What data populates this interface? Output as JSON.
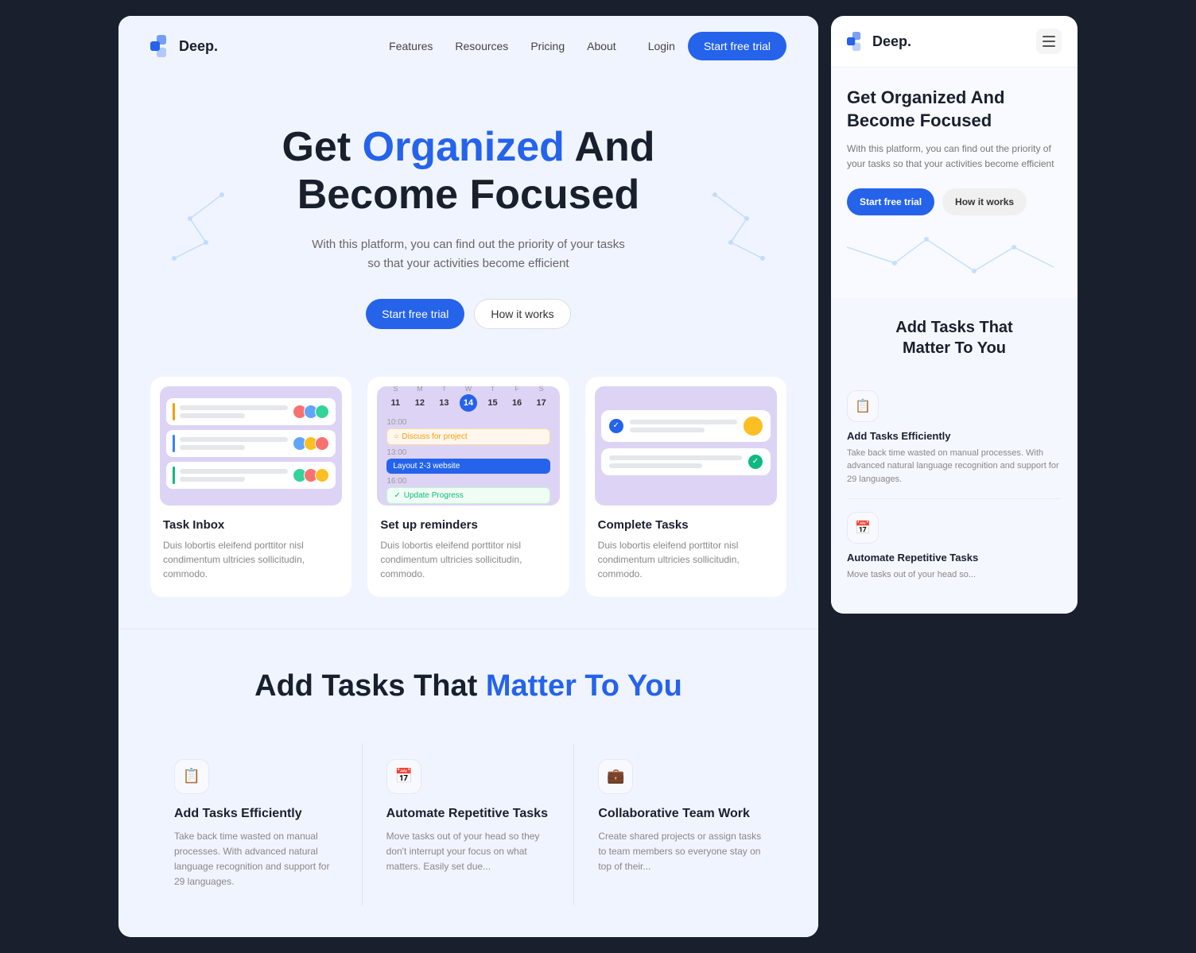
{
  "brand": {
    "name": "Deep.",
    "logo_alt": "Deep logo"
  },
  "nav": {
    "links": [
      {
        "label": "Features",
        "has_arrow": true
      },
      {
        "label": "Resources",
        "has_arrow": true
      },
      {
        "label": "Pricing",
        "has_arrow": false
      },
      {
        "label": "About",
        "has_arrow": false
      }
    ],
    "login_label": "Login",
    "cta_label": "Start free trial"
  },
  "hero": {
    "title_part1": "Get ",
    "title_highlight": "Organized",
    "title_part2": " And",
    "title_line2": "Become Focused",
    "subtitle": "With this platform, you can find out the priority of your tasks so that your activities become efficient",
    "cta_primary": "Start free trial",
    "cta_secondary": "How it works"
  },
  "cards": [
    {
      "id": "task-inbox",
      "title": "Task Inbox",
      "desc": "Duis lobortis eleifend porttitor nisl condimentum ultricies sollicitudin, commodo."
    },
    {
      "id": "set-up-reminders",
      "title": "Set up reminders",
      "desc": "Duis lobortis eleifend porttitor nisl condimentum ultricies sollicitudin, commodo."
    },
    {
      "id": "complete-tasks",
      "title": "Complete Tasks",
      "desc": "Duis lobortis eleifend porttitor nisl condimentum ultricies sollicitudin, commodo."
    }
  ],
  "tasks_section": {
    "title_part1": "Add Tasks That ",
    "title_highlight": "Matter To You"
  },
  "features": [
    {
      "id": "add-tasks",
      "icon": "📋",
      "title": "Add Tasks Efficiently",
      "desc": "Take back time wasted on manual processes. With advanced natural language recognition and support for 29 languages."
    },
    {
      "id": "automate",
      "icon": "📅",
      "title": "Automate Repetitive Tasks",
      "desc": "Move tasks out of your head so they don't interrupt your focus on what matters. Easily set due..."
    },
    {
      "id": "collaborate",
      "icon": "💼",
      "title": "Collaborative Team Work",
      "desc": "Create shared projects or assign tasks to team members so everyone stay on top of their..."
    }
  ],
  "calendar": {
    "days": [
      "S",
      "M",
      "T",
      "W",
      "T",
      "F",
      "S"
    ],
    "dates": [
      "11",
      "12",
      "13",
      "14",
      "15",
      "16",
      "17"
    ],
    "active_day": "14",
    "events": [
      {
        "time": "10:00",
        "label": "Discuss for project",
        "type": "orange"
      },
      {
        "time": "13:00",
        "label": "Layout 2-3 website",
        "type": "blue"
      },
      {
        "time": "16:00",
        "label": "Update Progress",
        "type": "green"
      }
    ]
  },
  "right_panel": {
    "hero": {
      "title_part1": "Get ",
      "title_highlight": "Organized",
      "title_part2": " And\nBecome Focused",
      "subtitle": "With this platform, you can find out the priority of your tasks so that your activities become efficient",
      "cta_primary": "Start free trial",
      "cta_secondary": "How it works"
    },
    "tasks_section": {
      "title_part1": "Add ",
      "title_highlight": "Tasks",
      "title_part2": " That\nMatter To You"
    },
    "features": [
      {
        "id": "add-tasks-right",
        "icon": "📋",
        "title": "Add Tasks Efficiently",
        "desc": "Take back time wasted on manual processes. With advanced natural language recognition and support for 29 languages."
      },
      {
        "id": "automate-right",
        "icon": "📅",
        "title": "Automate Repetitive Tasks",
        "desc": "Move tasks out of your head so..."
      }
    ]
  }
}
